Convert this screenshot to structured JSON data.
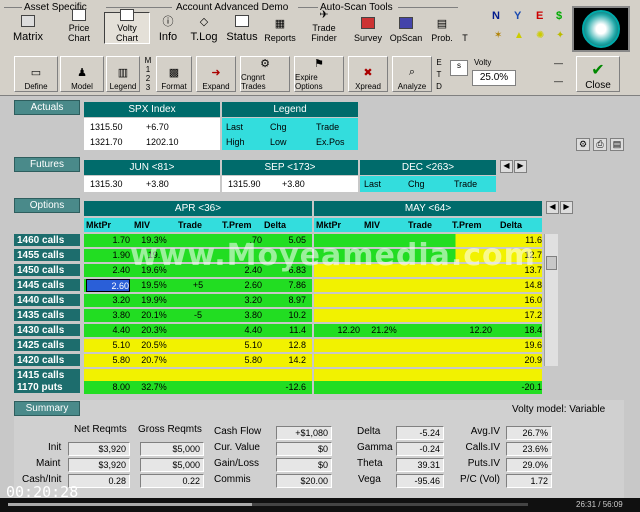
{
  "toolbar": {
    "groups": [
      "Asset Specific",
      "Account Advanced Demo",
      "Auto-Scan Tools"
    ],
    "row1": [
      "Matrix",
      "Price Chart",
      "Volty Chart",
      "Info",
      "T.Log",
      "Status",
      "Reports",
      "Trade Finder",
      "Survey",
      "OpScan",
      "Prob.",
      "T"
    ],
    "row2": [
      "Define",
      "Model",
      "Legend",
      "Format",
      "Expand",
      "Cngnrt Trades",
      "Expire Options",
      "Xpread",
      "Analyze"
    ],
    "side_letters": [
      "M",
      "1",
      "2",
      "3"
    ],
    "etd": [
      "E",
      "T",
      "D"
    ],
    "volty_label": "Volty",
    "volty_value": "25.0%",
    "s_value": "s",
    "close_label": "Close",
    "right_icons": [
      "N",
      "Y",
      "E",
      "$"
    ]
  },
  "actuals": {
    "label": "Actuals",
    "index_title": "SPX Index",
    "row1": [
      "1315.50",
      "+6.70"
    ],
    "row2": [
      "1321.70",
      "1202.10"
    ],
    "legend_title": "Legend",
    "legend_row1": [
      "Last",
      "Chg",
      "Trade"
    ],
    "legend_row2": [
      "High",
      "Low",
      "Ex.Pos"
    ]
  },
  "futures": {
    "label": "Futures",
    "jun_title": "JUN <81>",
    "jun_values": [
      "1315.30",
      "+3.80"
    ],
    "sep_title": "SEP <173>",
    "sep_values": [
      "1315.90",
      "+3.80"
    ],
    "dec_title": "DEC <263>",
    "dec_legend": [
      "Last",
      "Chg",
      "Trade"
    ]
  },
  "options": {
    "label": "Options",
    "apr_title": "APR <36>",
    "may_title": "MAY <64>",
    "columns": [
      "MktPr",
      "MIV",
      "Trade",
      "T.Prem",
      "Delta"
    ],
    "strikes": [
      "1460 calls",
      "1455 calls",
      "1450 calls",
      "1445 calls",
      "1440 calls",
      "1435 calls",
      "1430 calls",
      "1425 calls",
      "1420 calls",
      "1415 calls"
    ],
    "apr_rows": [
      [
        "1.70",
        "19.3%",
        "",
        ".70",
        "5.05"
      ],
      [
        "1.90",
        "19.",
        "",
        "",
        ""
      ],
      [
        "2.40",
        "19.6%",
        "",
        "2.40",
        "6.83"
      ],
      [
        "2.60",
        "19.5%",
        "+5",
        "2.60",
        "7.86"
      ],
      [
        "3.20",
        "19.9%",
        "",
        "3.20",
        "8.97"
      ],
      [
        "3.80",
        "20.1%",
        "-5",
        "3.80",
        "10.2"
      ],
      [
        "4.40",
        "20.3%",
        "",
        "4.40",
        "11.4"
      ],
      [
        "5.10",
        "20.5%",
        "",
        "5.10",
        "12.8"
      ],
      [
        "5.80",
        "20.7%",
        "",
        "5.80",
        "14.2"
      ],
      [
        "",
        "",
        "",
        "",
        ""
      ]
    ],
    "may_rows": [
      [
        "",
        "",
        "",
        "",
        "11.6"
      ],
      [
        "",
        "",
        "",
        "",
        "12.7"
      ],
      [
        "",
        "",
        "",
        "",
        "13.7"
      ],
      [
        "",
        "",
        "",
        "",
        "14.8"
      ],
      [
        "",
        "",
        "",
        "",
        "16.0"
      ],
      [
        "",
        "",
        "",
        "",
        "17.2"
      ],
      [
        "12.20",
        "21.2%",
        "",
        "12.20",
        "18.4"
      ],
      [
        "",
        "",
        "",
        "",
        "19.6"
      ],
      [
        "",
        "",
        "",
        "",
        "20.9"
      ],
      [
        "",
        "",
        "",
        "",
        ""
      ]
    ],
    "puts_label": "1170 puts",
    "puts_apr": [
      "8.00",
      "32.7%",
      "",
      "",
      "-12.6"
    ],
    "puts_may_delta": "-20.1"
  },
  "summary": {
    "label": "Summary",
    "volty_model": "Volty model: Variable",
    "headers": [
      "Net Reqmts",
      "Gross Reqmts"
    ],
    "rows": [
      {
        "label": "Init",
        "net": "$3,920",
        "gross": "$5,000"
      },
      {
        "label": "Maint",
        "net": "$3,920",
        "gross": "$5,000"
      },
      {
        "label": "Cash/Init",
        "net": "0.28",
        "gross": "0.22"
      }
    ],
    "mid": [
      {
        "label": "Cash Flow",
        "value": "+$1,080"
      },
      {
        "label": "Cur. Value",
        "value": "$0"
      },
      {
        "label": "Gain/Loss",
        "value": "$0"
      },
      {
        "label": "Commis",
        "value": "$20.00"
      }
    ],
    "greeks": [
      {
        "label": "Delta",
        "value": "-5.24"
      },
      {
        "label": "Gamma",
        "value": "-0.24"
      },
      {
        "label": "Theta",
        "value": "39.31"
      },
      {
        "label": "Vega",
        "value": "-95.46"
      }
    ],
    "iv": [
      {
        "label": "Avg.IV",
        "value": "26.7%"
      },
      {
        "label": "Calls.IV",
        "value": "23.6%"
      },
      {
        "label": "Puts.IV",
        "value": "29.0%"
      },
      {
        "label": "P/C (Vol)",
        "value": "1.72"
      }
    ]
  },
  "video": {
    "elapsed": "00:20:28",
    "progress_time": "26:31 / 56:09",
    "progress_fraction": 0.47,
    "watermark": "www.Moyeamedia.com"
  }
}
